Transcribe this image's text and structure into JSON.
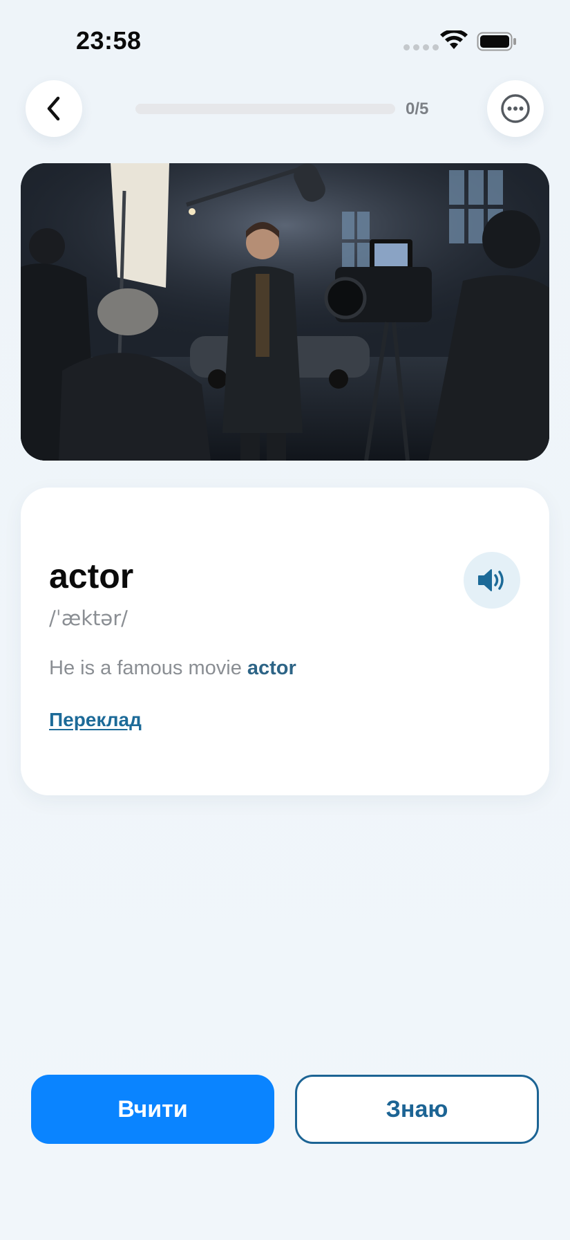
{
  "status": {
    "time": "23:58"
  },
  "header": {
    "progress_text": "0/5",
    "progress_fraction": 0
  },
  "card": {
    "word": "actor",
    "transcription": "/ˈæktər/",
    "example_before": "He is a famous movie ",
    "example_highlight": "actor",
    "translation_link": "Переклад"
  },
  "actions": {
    "learn_label": "Вчити",
    "know_label": "Знаю"
  },
  "icons": {
    "back": "chevron-left-icon",
    "more": "more-horizontal-icon",
    "speaker": "speaker-icon",
    "wifi": "wifi-icon",
    "battery": "battery-icon"
  },
  "colors": {
    "primary": "#0a84ff",
    "accent_dark": "#1c6494",
    "highlight": "#2d6486"
  }
}
